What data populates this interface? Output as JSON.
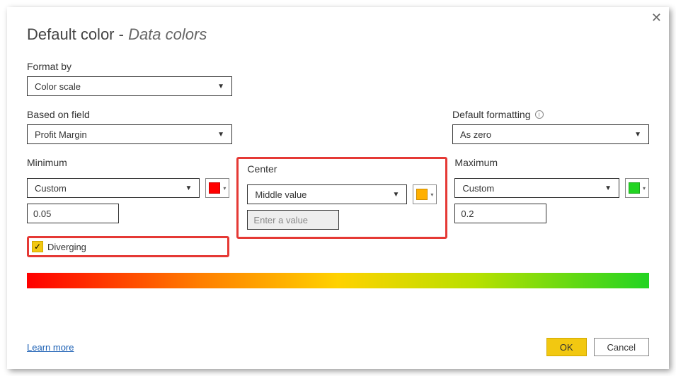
{
  "title_main": "Default color - ",
  "title_sub": "Data colors",
  "format_by": {
    "label": "Format by",
    "value": "Color scale"
  },
  "based_on": {
    "label": "Based on field",
    "value": "Profit Margin"
  },
  "default_fmt": {
    "label": "Default formatting",
    "value": "As zero"
  },
  "minimum": {
    "label": "Minimum",
    "mode": "Custom",
    "value": "0.05",
    "color": "#ff0000"
  },
  "center": {
    "label": "Center",
    "mode": "Middle value",
    "placeholder": "Enter a value",
    "color": "#ffb000"
  },
  "maximum": {
    "label": "Maximum",
    "mode": "Custom",
    "value": "0.2",
    "color": "#22d422"
  },
  "diverging_label": "Diverging",
  "learn_more": "Learn more",
  "ok": "OK",
  "cancel": "Cancel"
}
